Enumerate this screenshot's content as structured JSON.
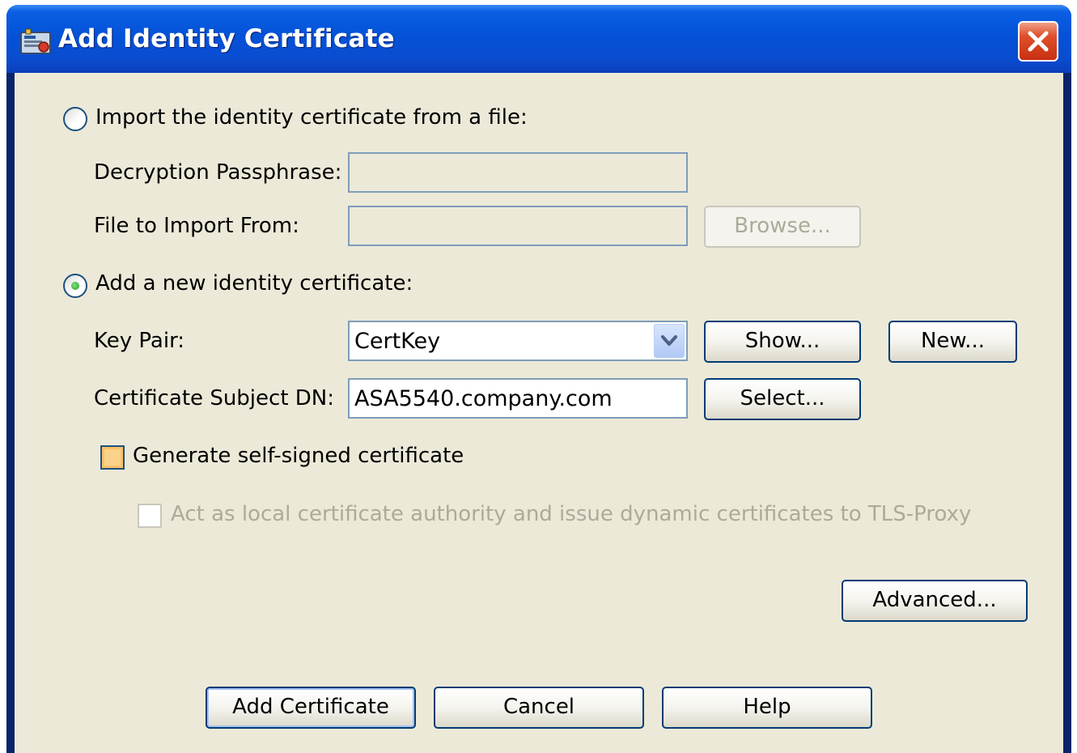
{
  "window": {
    "title": "Add Identity Certificate"
  },
  "import_option": {
    "label": "Import the identity certificate from a file:",
    "selected": false,
    "passphrase_label": "Decryption Passphrase:",
    "passphrase_value": "",
    "file_label": "File to Import From:",
    "file_value": "",
    "browse_label": "Browse..."
  },
  "new_option": {
    "label": "Add a new identity certificate:",
    "selected": true,
    "key_pair_label": "Key Pair:",
    "key_pair_value": "CertKey",
    "show_label": "Show...",
    "new_label": "New...",
    "subject_dn_label": "Certificate Subject DN:",
    "subject_dn_value": "ASA5540.company.com",
    "select_label": "Select...",
    "self_signed_label": "Generate self-signed certificate",
    "self_signed_checked": false,
    "local_ca_label": "Act as local certificate authority and issue dynamic certificates to TLS-Proxy",
    "local_ca_checked": false
  },
  "advanced_label": "Advanced...",
  "footer": {
    "add_label": "Add Certificate",
    "cancel_label": "Cancel",
    "help_label": "Help"
  },
  "colors": {
    "titlebar": "#0452d8",
    "dialog_bg": "#ece9d8",
    "close_button": "#e0502c"
  }
}
